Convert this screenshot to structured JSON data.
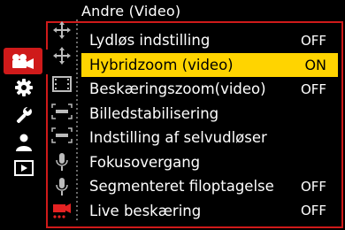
{
  "menu": {
    "title": "Andre (Video)",
    "rows": [
      {
        "label": "Lydløs indstilling",
        "value": "OFF"
      },
      {
        "label": "Hybridzoom (video)",
        "value": "ON"
      },
      {
        "label": "Beskæringszoom(video)",
        "value": "OFF"
      },
      {
        "label": "Billedstabilisering",
        "value": ""
      },
      {
        "label": "Indstilling af selvudløser",
        "value": ""
      },
      {
        "label": "Fokusovergang",
        "value": ""
      },
      {
        "label": "Segmenteret filoptagelse",
        "value": "OFF"
      },
      {
        "label": "Live beskæring",
        "value": "OFF"
      }
    ],
    "selected_index": 1
  },
  "tabs": [
    {
      "icon": "video-camera-icon",
      "active": true
    },
    {
      "icon": "gear-icon",
      "active": false
    },
    {
      "icon": "wrench-icon",
      "active": false
    },
    {
      "icon": "person-icon",
      "active": false
    },
    {
      "icon": "playback-icon",
      "active": false
    }
  ],
  "subtabs": [
    "crosshair-arrows-icon",
    "crosshair-arrows-icon",
    "film-strip-icon",
    "focus-icon",
    "focus-icon",
    "microphone-icon",
    "microphone-icon",
    "video-other-icon"
  ],
  "colors": {
    "accent": "#cf1a1a",
    "highlight": "#ffd400",
    "background": "#000000",
    "text": "#ffffff"
  }
}
